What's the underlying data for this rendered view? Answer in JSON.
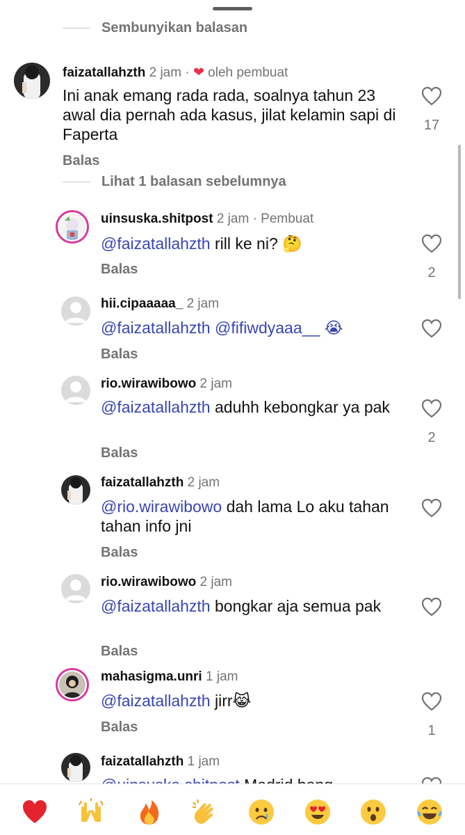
{
  "toggles": {
    "hide_replies": "Sembunyikan balasan",
    "view_previous": "Lihat 1 balasan sebelumnya"
  },
  "main_comment": {
    "user": "faizatallahzth",
    "time": "2 jam",
    "liked_by": "oleh pembuat",
    "text": "Ini anak emang rada rada, soalnya tahun 23 awal dia pernah ada kasus, jilat kelamin sapi di Faperta",
    "reply": "Balas",
    "likes": "17"
  },
  "replies": [
    {
      "user": "uinsuska.shitpost",
      "time": "2 jam",
      "extra": "Pembuat",
      "mention": "@faizatallahzth",
      "text": " rill ke ni? 🤔",
      "reply": "Balas",
      "likes": "2"
    },
    {
      "user": "hii.cipaaaaa_",
      "time": "2 jam",
      "extra": "",
      "mention": "@faizatallahzth",
      "text": " @fifiwdyaaa__ 😭",
      "reply": "Balas",
      "likes": ""
    },
    {
      "user": "rio.wirawibowo",
      "time": "2 jam",
      "extra": "",
      "mention": "@faizatallahzth",
      "text": " aduhh kebongkar ya pak",
      "reply": "Balas",
      "likes": "2"
    },
    {
      "user": "faizatallahzth",
      "time": "2 jam",
      "extra": "",
      "mention": "@rio.wirawibowo",
      "text": " dah lama Lo aku tahan tahan info jni",
      "reply": "Balas",
      "likes": ""
    },
    {
      "user": "rio.wirawibowo",
      "time": "2 jam",
      "extra": "",
      "mention": "@faizatallahzth",
      "text": " bongkar aja semua pak",
      "reply": "Balas",
      "likes": ""
    },
    {
      "user": "mahasigma.unri",
      "time": "1 jam",
      "extra": "",
      "mention": "@faizatallahzth",
      "text": " jirr😹",
      "reply": "Balas",
      "likes": "1"
    },
    {
      "user": "faizatallahzth",
      "time": "1 jam",
      "extra": "",
      "mention": "@uinsuska.shitpost",
      "text": " Madrid bang",
      "reply": "",
      "likes": ""
    }
  ],
  "emoji_bar": [
    {
      "name": "red-heart",
      "glyph": "❤️"
    },
    {
      "name": "raising-hands",
      "glyph": "🙌"
    },
    {
      "name": "fire",
      "glyph": "🔥"
    },
    {
      "name": "clapping-hands",
      "glyph": "👏"
    },
    {
      "name": "crying-face",
      "glyph": "😢"
    },
    {
      "name": "heart-eyes",
      "glyph": "😍"
    },
    {
      "name": "surprised-face",
      "glyph": "😮"
    },
    {
      "name": "tears-of-joy",
      "glyph": "😂"
    }
  ],
  "colors": {
    "mention": "#3845b4",
    "heart": "#ed2e47",
    "secondary": "#737373"
  }
}
